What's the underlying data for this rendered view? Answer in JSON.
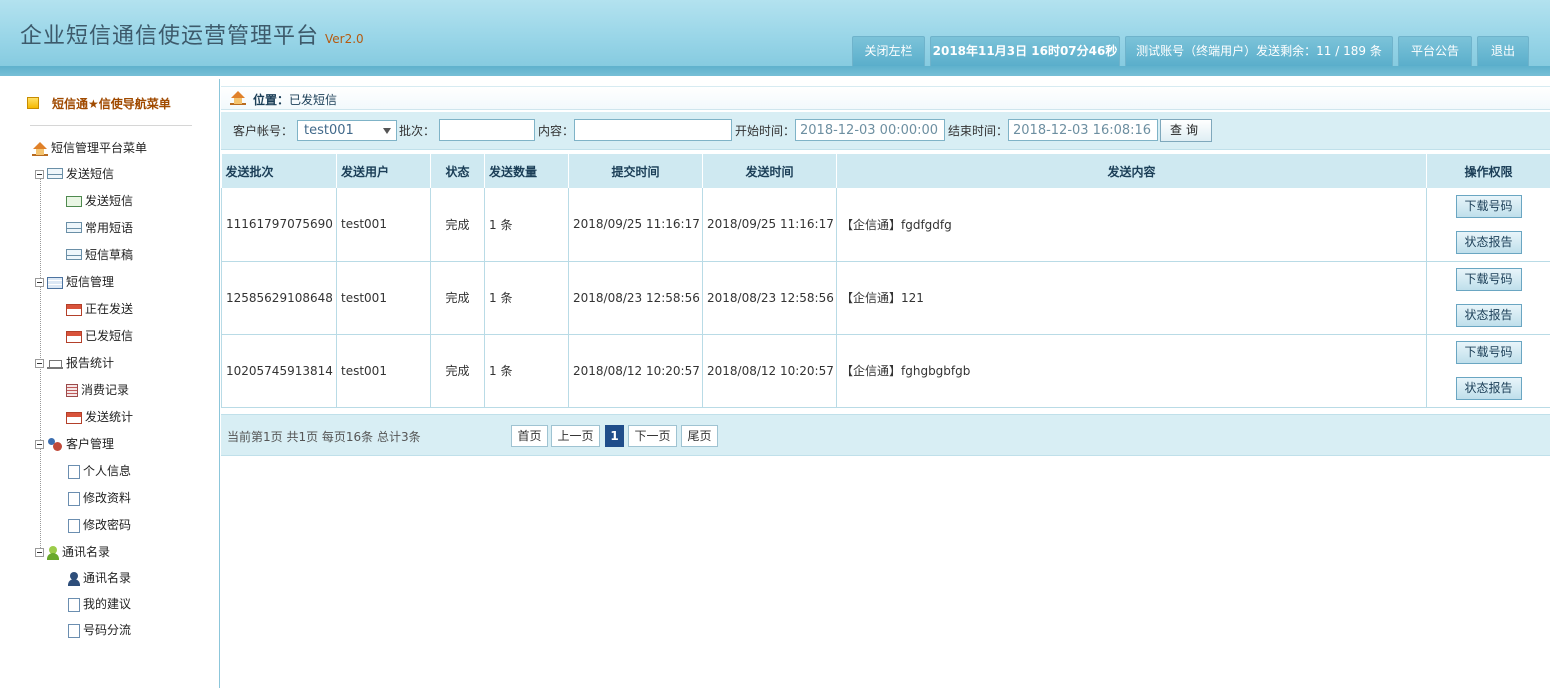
{
  "header": {
    "title": "企业短信通信使运营管理平台",
    "version": "Ver2.0",
    "close_sidebar": "关闭左栏",
    "datetime": "2018年11月3日 16时07分46秒",
    "account_info": "测试账号（终端用户）发送剩余：11 / 189 条",
    "announcement": "平台公告",
    "logout": "退出"
  },
  "sidebar": {
    "nav_title": "短信通★信使导航菜单",
    "root": "短信管理平台菜单",
    "groups": [
      {
        "label": "发送短信",
        "items": [
          "发送短信",
          "常用短语",
          "短信草稿"
        ]
      },
      {
        "label": "短信管理",
        "items": [
          "正在发送",
          "已发短信"
        ]
      },
      {
        "label": "报告统计",
        "items": [
          "消费记录",
          "发送统计"
        ]
      },
      {
        "label": "客户管理",
        "items": [
          "个人信息",
          "修改资料",
          "修改密码"
        ]
      },
      {
        "label": "通讯名录",
        "items": [
          "通讯名录",
          "我的建议",
          "号码分流"
        ]
      }
    ]
  },
  "location": {
    "label": "位置：",
    "value": "已发短信"
  },
  "filters": {
    "account_label": "客户帐号：",
    "account_value": "test001",
    "batch_label": "批次：",
    "batch_value": "",
    "content_label": "内容：",
    "content_value": "",
    "start_label": "开始时间：",
    "start_value": "2018-12-03 00:00:00",
    "end_label": "结束时间：",
    "end_value": "2018-12-03 16:08:16",
    "query_label": "查询"
  },
  "table": {
    "columns": [
      "发送批次",
      "发送用户",
      "状态",
      "发送数量",
      "提交时间",
      "发送时间",
      "发送内容",
      "操作权限"
    ],
    "rows": [
      {
        "batch": "11161797075690",
        "user": "test001",
        "status": "完成",
        "count": "1 条",
        "submit_time": "2018/09/25 11:16:17",
        "send_time": "2018/09/25 11:16:17",
        "content": "【企信通】fgdfgdfg",
        "btn_download": "下载号码",
        "btn_report": "状态报告"
      },
      {
        "batch": "12585629108648",
        "user": "test001",
        "status": "完成",
        "count": "1 条",
        "submit_time": "2018/08/23 12:58:56",
        "send_time": "2018/08/23 12:58:56",
        "content": "【企信通】121",
        "btn_download": "下载号码",
        "btn_report": "状态报告"
      },
      {
        "batch": "10205745913814",
        "user": "test001",
        "status": "完成",
        "count": "1 条",
        "submit_time": "2018/08/12 10:20:57",
        "send_time": "2018/08/12 10:20:57",
        "content": "【企信通】fghgbgbfgb",
        "btn_download": "下载号码",
        "btn_report": "状态报告"
      }
    ]
  },
  "pager": {
    "info": "当前第1页 共1页 每页16条 总计3条",
    "first": "首页",
    "prev": "上一页",
    "current": "1",
    "next": "下一页",
    "last": "尾页"
  }
}
